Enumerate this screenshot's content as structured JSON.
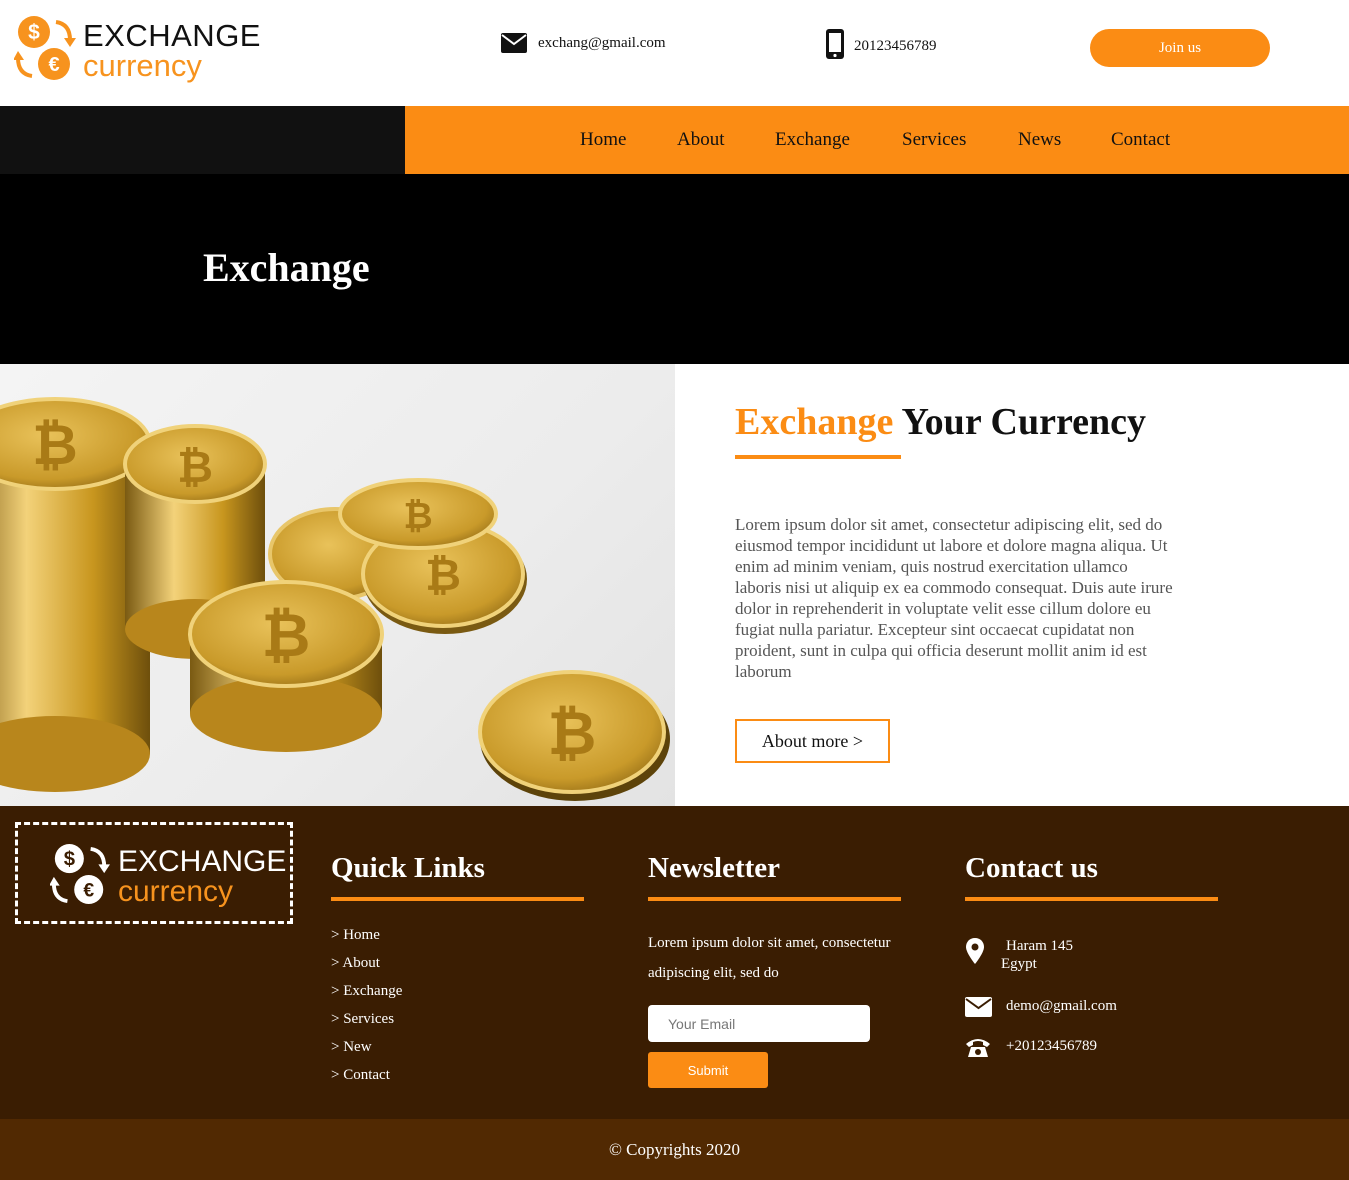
{
  "brand": {
    "line1": "EXCHANGE",
    "line2": "currency",
    "accent_color": "#fb8c14",
    "logo_icon": "currency-exchange-icon"
  },
  "header": {
    "email": "exchang@gmail.com",
    "phone": "20123456789",
    "join_label": "Join us",
    "email_icon": "envelope-icon",
    "phone_icon": "mobile-phone-icon"
  },
  "nav": {
    "items": [
      "Home",
      "About",
      "Exchange",
      "Services",
      "News",
      "Contact"
    ]
  },
  "banner": {
    "title": "Exchange"
  },
  "content": {
    "title_accent": "Exchange",
    "title_rest": "Your Currency",
    "body": "Lorem ipsum dolor sit amet, consectetur adipiscing elit, sed do eiusmod tempor incididunt ut labore et dolore magna aliqua. Ut enim ad minim veniam, quis nostrud exercitation ullamco laboris nisi ut aliquip ex ea commodo consequat. Duis aute irure dolor in reprehenderit in voluptate velit esse cillum dolore eu fugiat nulla pariatur. Excepteur sint occaecat cupidatat non proident, sunt in culpa qui officia deserunt mollit anim id est laborum",
    "button_label": "About more >",
    "image": "bitcoin-coins-image"
  },
  "footer": {
    "quick_links": {
      "title": "Quick Links",
      "items": [
        "> Home",
        "> About",
        "> Exchange",
        "> Services",
        "> New",
        "> Contact"
      ]
    },
    "newsletter": {
      "title": "Newsletter",
      "text": "Lorem ipsum dolor sit amet, consectetur adipiscing elit, sed do",
      "placeholder": "Your Email",
      "submit_label": "Submit"
    },
    "contact": {
      "title": "Contact us",
      "address_line1": "Haram 145",
      "address_line2": "Egypt",
      "email": "demo@gmail.com",
      "phone": "+20123456789"
    },
    "copyright": "© Copyrights 2020"
  }
}
